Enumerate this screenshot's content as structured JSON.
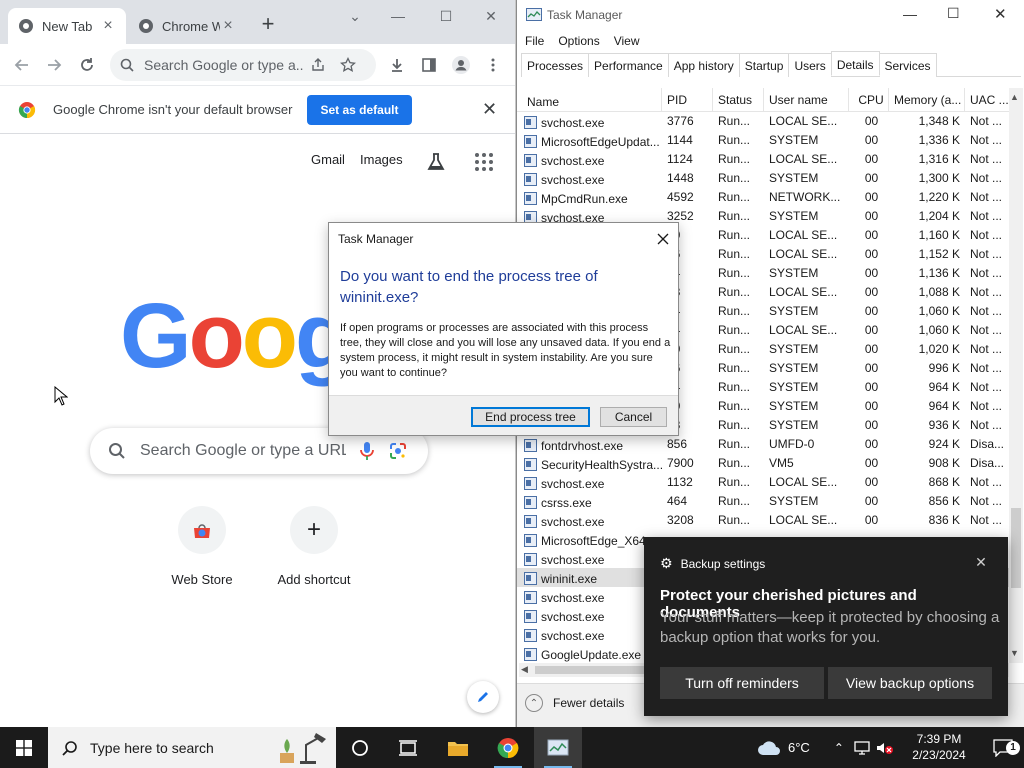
{
  "chrome": {
    "tabs": [
      {
        "title": "New Tab",
        "active": true
      },
      {
        "title": "Chrome W",
        "active": false
      }
    ],
    "new_tab_symbol": "+",
    "omnibox_placeholder": "Search Google or type a...",
    "default_bar": {
      "message": "Google Chrome isn't your default browser",
      "button": "Set as default"
    },
    "ntp": {
      "links": [
        "Gmail",
        "Images"
      ],
      "logo_letters": [
        "G",
        "o",
        "o",
        "g"
      ],
      "logo_colors": [
        "#4285f4",
        "#ea4335",
        "#fbbc05",
        "#4285f4"
      ],
      "search_placeholder": "Search Google or type a URL",
      "shortcuts": [
        {
          "label": "Web Store",
          "icon": "webstore-icon"
        },
        {
          "label": "Add shortcut",
          "icon": "plus-icon",
          "symbol": "+"
        }
      ]
    }
  },
  "taskmgr": {
    "title": "Task Manager",
    "menu": [
      "File",
      "Options",
      "View"
    ],
    "tabs": [
      "Processes",
      "Performance",
      "App history",
      "Startup",
      "Users",
      "Details",
      "Services"
    ],
    "active_tab": "Details",
    "columns": [
      "Name",
      "PID",
      "Status",
      "User name",
      "CPU",
      "Memory (a...",
      "UAC ..."
    ],
    "rows": [
      {
        "name": "svchost.exe",
        "pid": "3776",
        "status": "Run...",
        "user": "LOCAL SE...",
        "cpu": "00",
        "mem": "1,348 K",
        "uac": "Not ..."
      },
      {
        "name": "MicrosoftEdgeUpdat...",
        "pid": "1144",
        "status": "Run...",
        "user": "SYSTEM",
        "cpu": "00",
        "mem": "1,336 K",
        "uac": "Not ..."
      },
      {
        "name": "svchost.exe",
        "pid": "1124",
        "status": "Run...",
        "user": "LOCAL SE...",
        "cpu": "00",
        "mem": "1,316 K",
        "uac": "Not ..."
      },
      {
        "name": "svchost.exe",
        "pid": "1448",
        "status": "Run...",
        "user": "SYSTEM",
        "cpu": "00",
        "mem": "1,300 K",
        "uac": "Not ..."
      },
      {
        "name": "MpCmdRun.exe",
        "pid": "4592",
        "status": "Run...",
        "user": "NETWORK...",
        "cpu": "00",
        "mem": "1,220 K",
        "uac": "Not ..."
      },
      {
        "name": "svchost.exe",
        "pid": "3252",
        "status": "Run...",
        "user": "SYSTEM",
        "cpu": "00",
        "mem": "1,204 K",
        "uac": "Not ..."
      },
      {
        "name": "",
        "pid": "20",
        "status": "Run...",
        "user": "LOCAL SE...",
        "cpu": "00",
        "mem": "1,160 K",
        "uac": "Not ..."
      },
      {
        "name": "",
        "pid": "96",
        "status": "Run...",
        "user": "LOCAL SE...",
        "cpu": "00",
        "mem": "1,152 K",
        "uac": "Not ..."
      },
      {
        "name": "",
        "pid": "44",
        "status": "Run...",
        "user": "SYSTEM",
        "cpu": "00",
        "mem": "1,136 K",
        "uac": "Not ..."
      },
      {
        "name": "",
        "pid": "88",
        "status": "Run...",
        "user": "LOCAL SE...",
        "cpu": "00",
        "mem": "1,088 K",
        "uac": "Not ..."
      },
      {
        "name": "",
        "pid": "24",
        "status": "Run...",
        "user": "SYSTEM",
        "cpu": "00",
        "mem": "1,060 K",
        "uac": "Not ..."
      },
      {
        "name": "",
        "pid": "04",
        "status": "Run...",
        "user": "LOCAL SE...",
        "cpu": "00",
        "mem": "1,060 K",
        "uac": "Not ..."
      },
      {
        "name": "",
        "pid": "60",
        "status": "Run...",
        "user": "SYSTEM",
        "cpu": "00",
        "mem": "1,020 K",
        "uac": "Not ..."
      },
      {
        "name": "",
        "pid": "36",
        "status": "Run...",
        "user": "SYSTEM",
        "cpu": "00",
        "mem": "996 K",
        "uac": "Not ..."
      },
      {
        "name": "",
        "pid": "84",
        "status": "Run...",
        "user": "SYSTEM",
        "cpu": "00",
        "mem": "964 K",
        "uac": "Not ..."
      },
      {
        "name": "",
        "pid": "40",
        "status": "Run...",
        "user": "SYSTEM",
        "cpu": "00",
        "mem": "964 K",
        "uac": "Not ..."
      },
      {
        "name": "",
        "pid": "18",
        "status": "Run...",
        "user": "SYSTEM",
        "cpu": "00",
        "mem": "936 K",
        "uac": "Not ..."
      },
      {
        "name": "fontdrvhost.exe",
        "pid": "856",
        "status": "Run...",
        "user": "UMFD-0",
        "cpu": "00",
        "mem": "924 K",
        "uac": "Disa..."
      },
      {
        "name": "SecurityHealthSystra...",
        "pid": "7900",
        "status": "Run...",
        "user": "VM5",
        "cpu": "00",
        "mem": "908 K",
        "uac": "Disa..."
      },
      {
        "name": "svchost.exe",
        "pid": "1132",
        "status": "Run...",
        "user": "LOCAL SE...",
        "cpu": "00",
        "mem": "868 K",
        "uac": "Not ..."
      },
      {
        "name": "csrss.exe",
        "pid": "464",
        "status": "Run...",
        "user": "SYSTEM",
        "cpu": "00",
        "mem": "856 K",
        "uac": "Not ..."
      },
      {
        "name": "svchost.exe",
        "pid": "3208",
        "status": "Run...",
        "user": "LOCAL SE...",
        "cpu": "00",
        "mem": "836 K",
        "uac": "Not ..."
      },
      {
        "name": "MicrosoftEdge_X64_",
        "pid": "",
        "status": "",
        "user": "",
        "cpu": "",
        "mem": "",
        "uac": ""
      },
      {
        "name": "svchost.exe",
        "pid": "",
        "status": "",
        "user": "",
        "cpu": "",
        "mem": "",
        "uac": ""
      },
      {
        "name": "wininit.exe",
        "pid": "",
        "status": "",
        "user": "",
        "cpu": "",
        "mem": "",
        "uac": "",
        "selected": true
      },
      {
        "name": "svchost.exe",
        "pid": "",
        "status": "",
        "user": "",
        "cpu": "",
        "mem": "",
        "uac": ""
      },
      {
        "name": "svchost.exe",
        "pid": "",
        "status": "",
        "user": "",
        "cpu": "",
        "mem": "",
        "uac": ""
      },
      {
        "name": "svchost.exe",
        "pid": "",
        "status": "",
        "user": "",
        "cpu": "",
        "mem": "",
        "uac": ""
      },
      {
        "name": "GoogleUpdate.exe",
        "pid": "",
        "status": "",
        "user": "",
        "cpu": "",
        "mem": "",
        "uac": ""
      }
    ],
    "fewer_details": "Fewer details"
  },
  "dialog": {
    "title": "Task Manager",
    "heading": "Do you want to end the process tree of wininit.exe?",
    "body": "If open programs or processes are associated with this process tree, they will close and you will lose any unsaved data. If you end a system process, it might result in system instability. Are you sure you want to continue?",
    "primary_button": "End process tree",
    "cancel_button": "Cancel"
  },
  "toast": {
    "app": "Backup settings",
    "heading": "Protect your cherished pictures and documents",
    "body": "Your stuff matters—keep it protected by choosing a backup option that works for you.",
    "buttons": [
      "Turn off reminders",
      "View backup options"
    ]
  },
  "taskbar": {
    "search_placeholder": "Type here to search",
    "weather": "6°C",
    "time": "7:39 PM",
    "date": "2/23/2024",
    "notification_count": "1"
  },
  "colors": {
    "accent": "#0078d7",
    "chrome_blue": "#1a73e8",
    "dialog_heading": "#1f3d99",
    "toast_bg": "#1f1f1f",
    "taskbar_bg": "#1b1b1b"
  }
}
